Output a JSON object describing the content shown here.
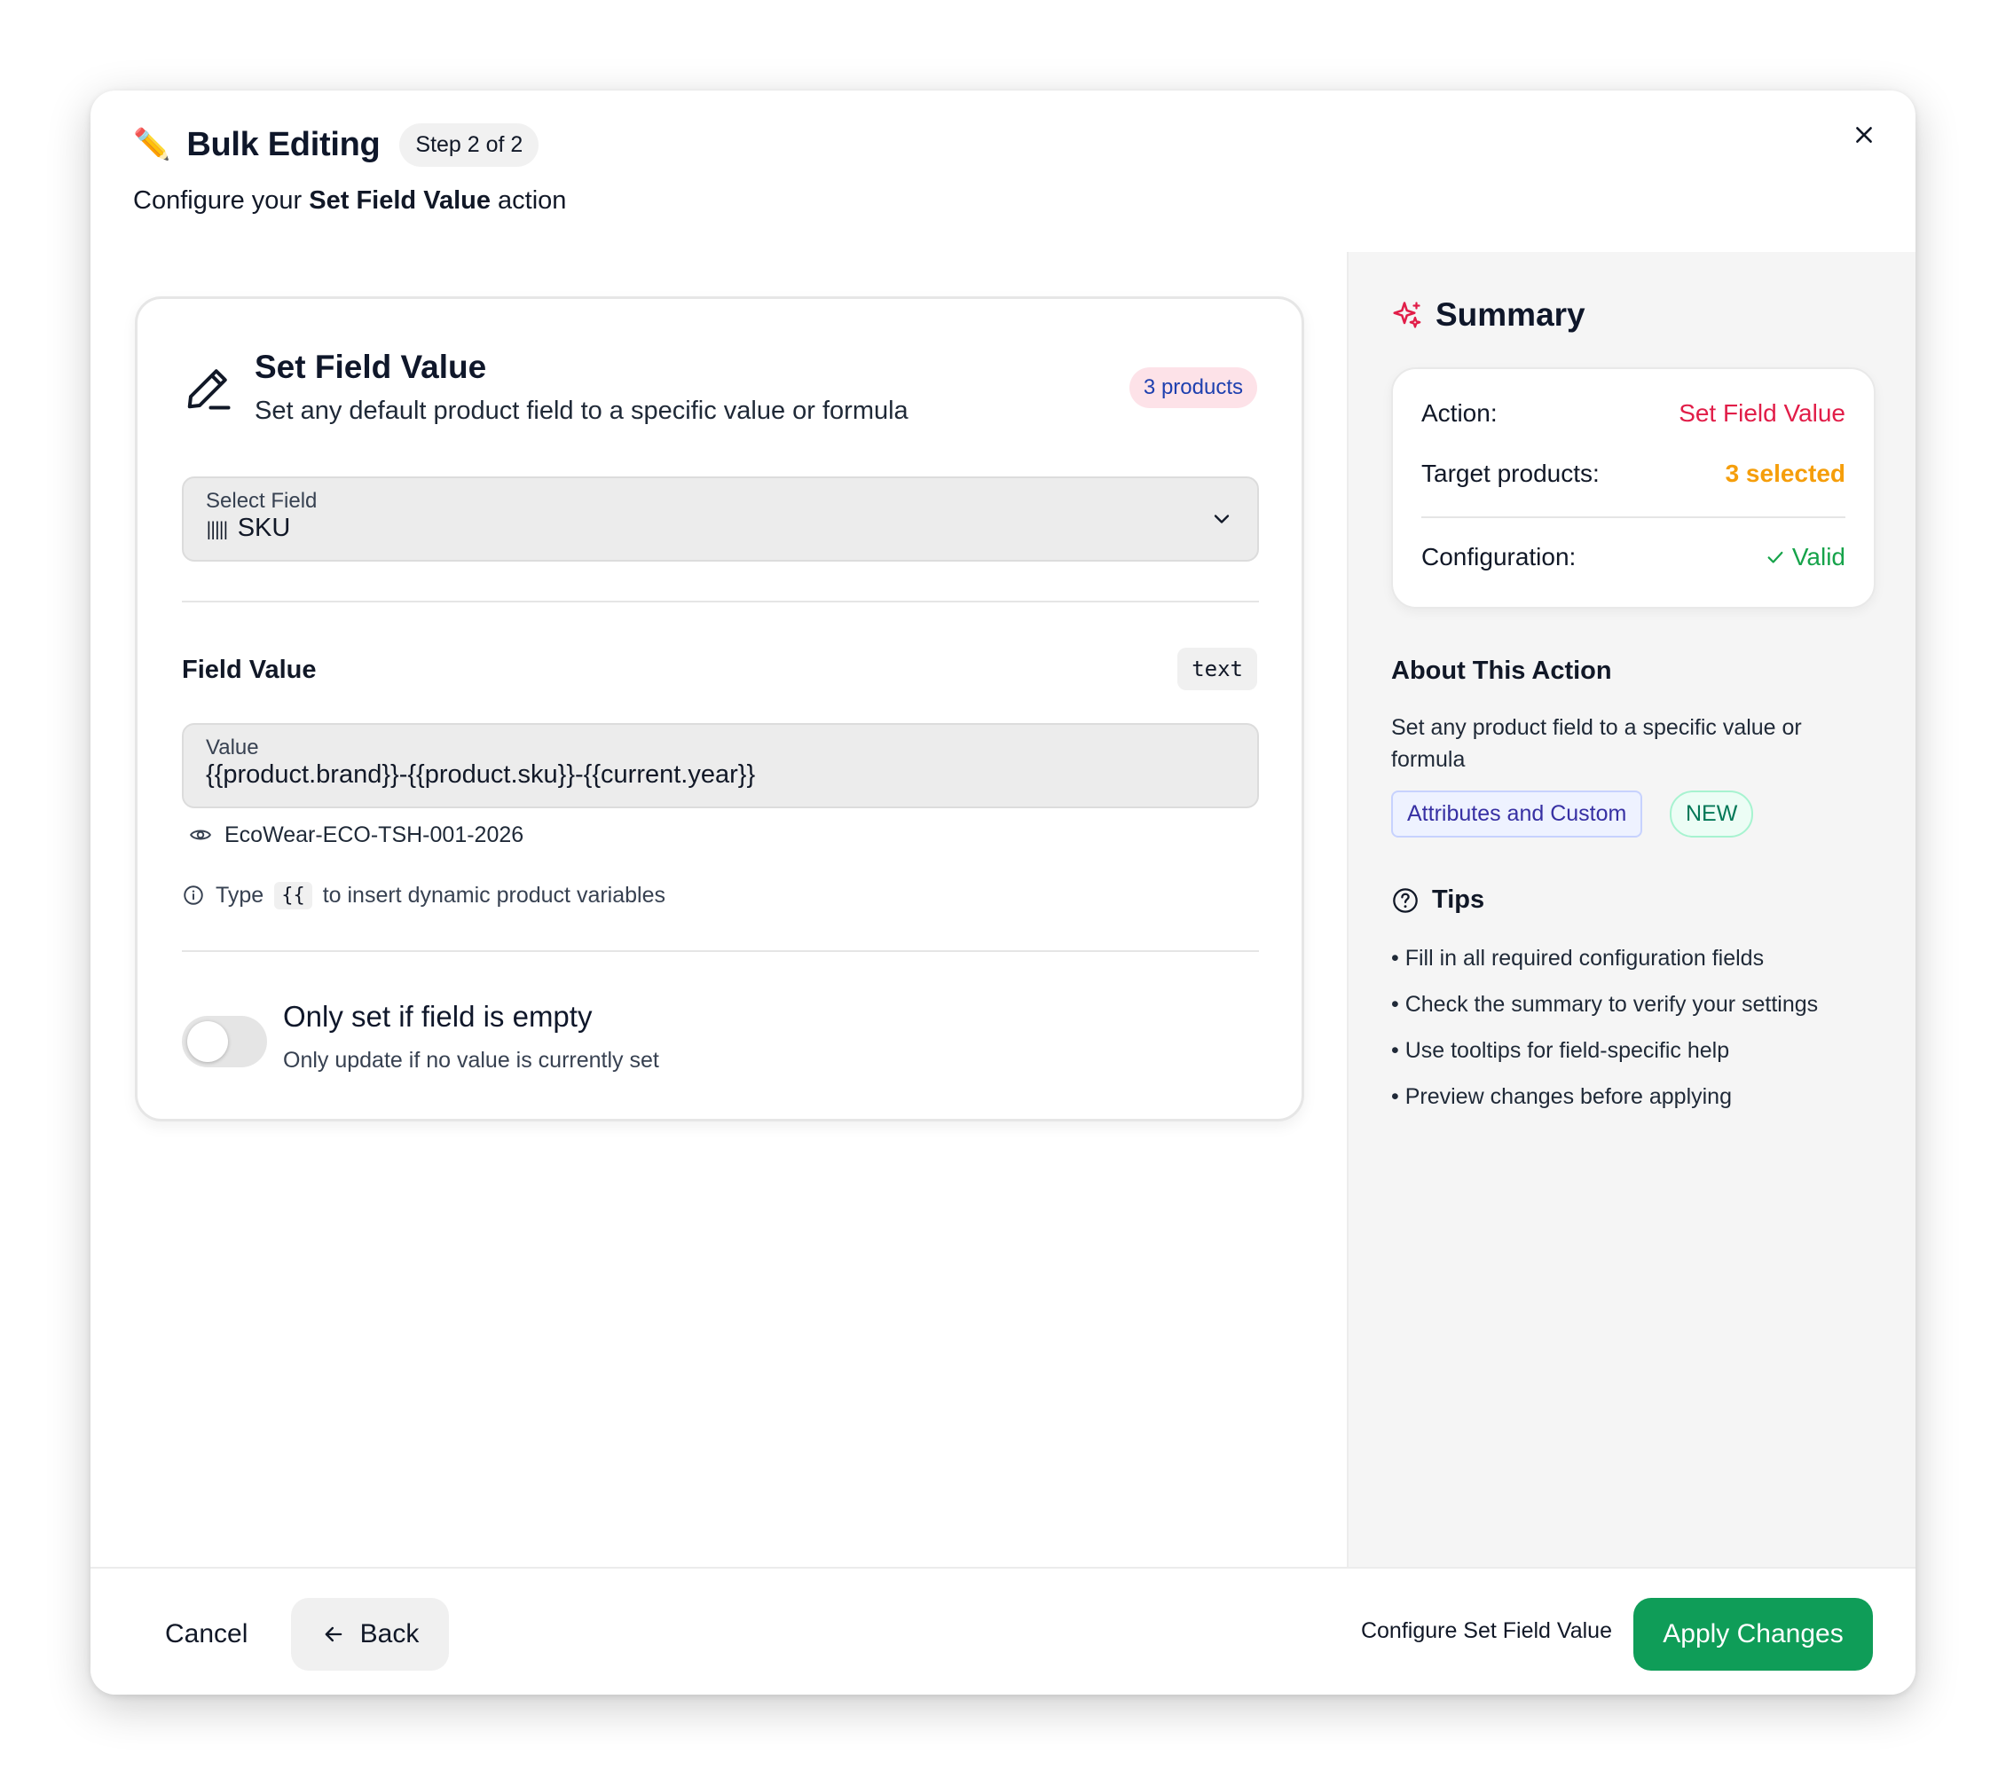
{
  "header": {
    "emoji": "✏️",
    "title": "Bulk Editing",
    "step": "Step 2 of 2",
    "subtitle_prefix": "Configure your ",
    "subtitle_bold": "Set Field Value",
    "subtitle_suffix": " action"
  },
  "card": {
    "title": "Set Field Value",
    "description": "Set any default product field to a specific value or formula",
    "products_badge": "3 products",
    "select": {
      "label": "Select Field",
      "value": "SKU",
      "icon": "barcode-icon"
    },
    "field_value": {
      "label": "Field Value",
      "type": "text",
      "input_label": "Value",
      "input_value": "{{product.brand}}-{{product.sku}}-{{current.year}}",
      "preview": "EcoWear-ECO-TSH-001-2026"
    },
    "hint": {
      "prefix": "Type",
      "code": "{{",
      "suffix": "to insert dynamic product variables"
    },
    "toggle": {
      "title": "Only set if field is empty",
      "subtitle": "Only update if no value is currently set",
      "on": false
    }
  },
  "summary": {
    "title": "Summary",
    "rows": [
      {
        "label": "Action:",
        "value": "Set Field Value"
      },
      {
        "label": "Target products:",
        "value": "3 selected"
      },
      {
        "label": "Configuration:",
        "value": "Valid"
      }
    ],
    "about_title": "About This Action",
    "about_desc": "Set any product field to a specific value or formula",
    "tags": [
      "Attributes and Custom",
      "NEW"
    ],
    "tips_title": "Tips",
    "tips": [
      "Fill in all required configuration fields",
      "Check the summary to verify your settings",
      "Use tooltips for field-specific help",
      "Preview changes before applying"
    ]
  },
  "footer": {
    "cancel": "Cancel",
    "back": "Back",
    "note": "Configure Set Field Value",
    "apply": "Apply Changes"
  },
  "colors": {
    "accent_green": "#0f9d58",
    "accent_red": "#e11d48",
    "accent_amber": "#f59e0b"
  }
}
